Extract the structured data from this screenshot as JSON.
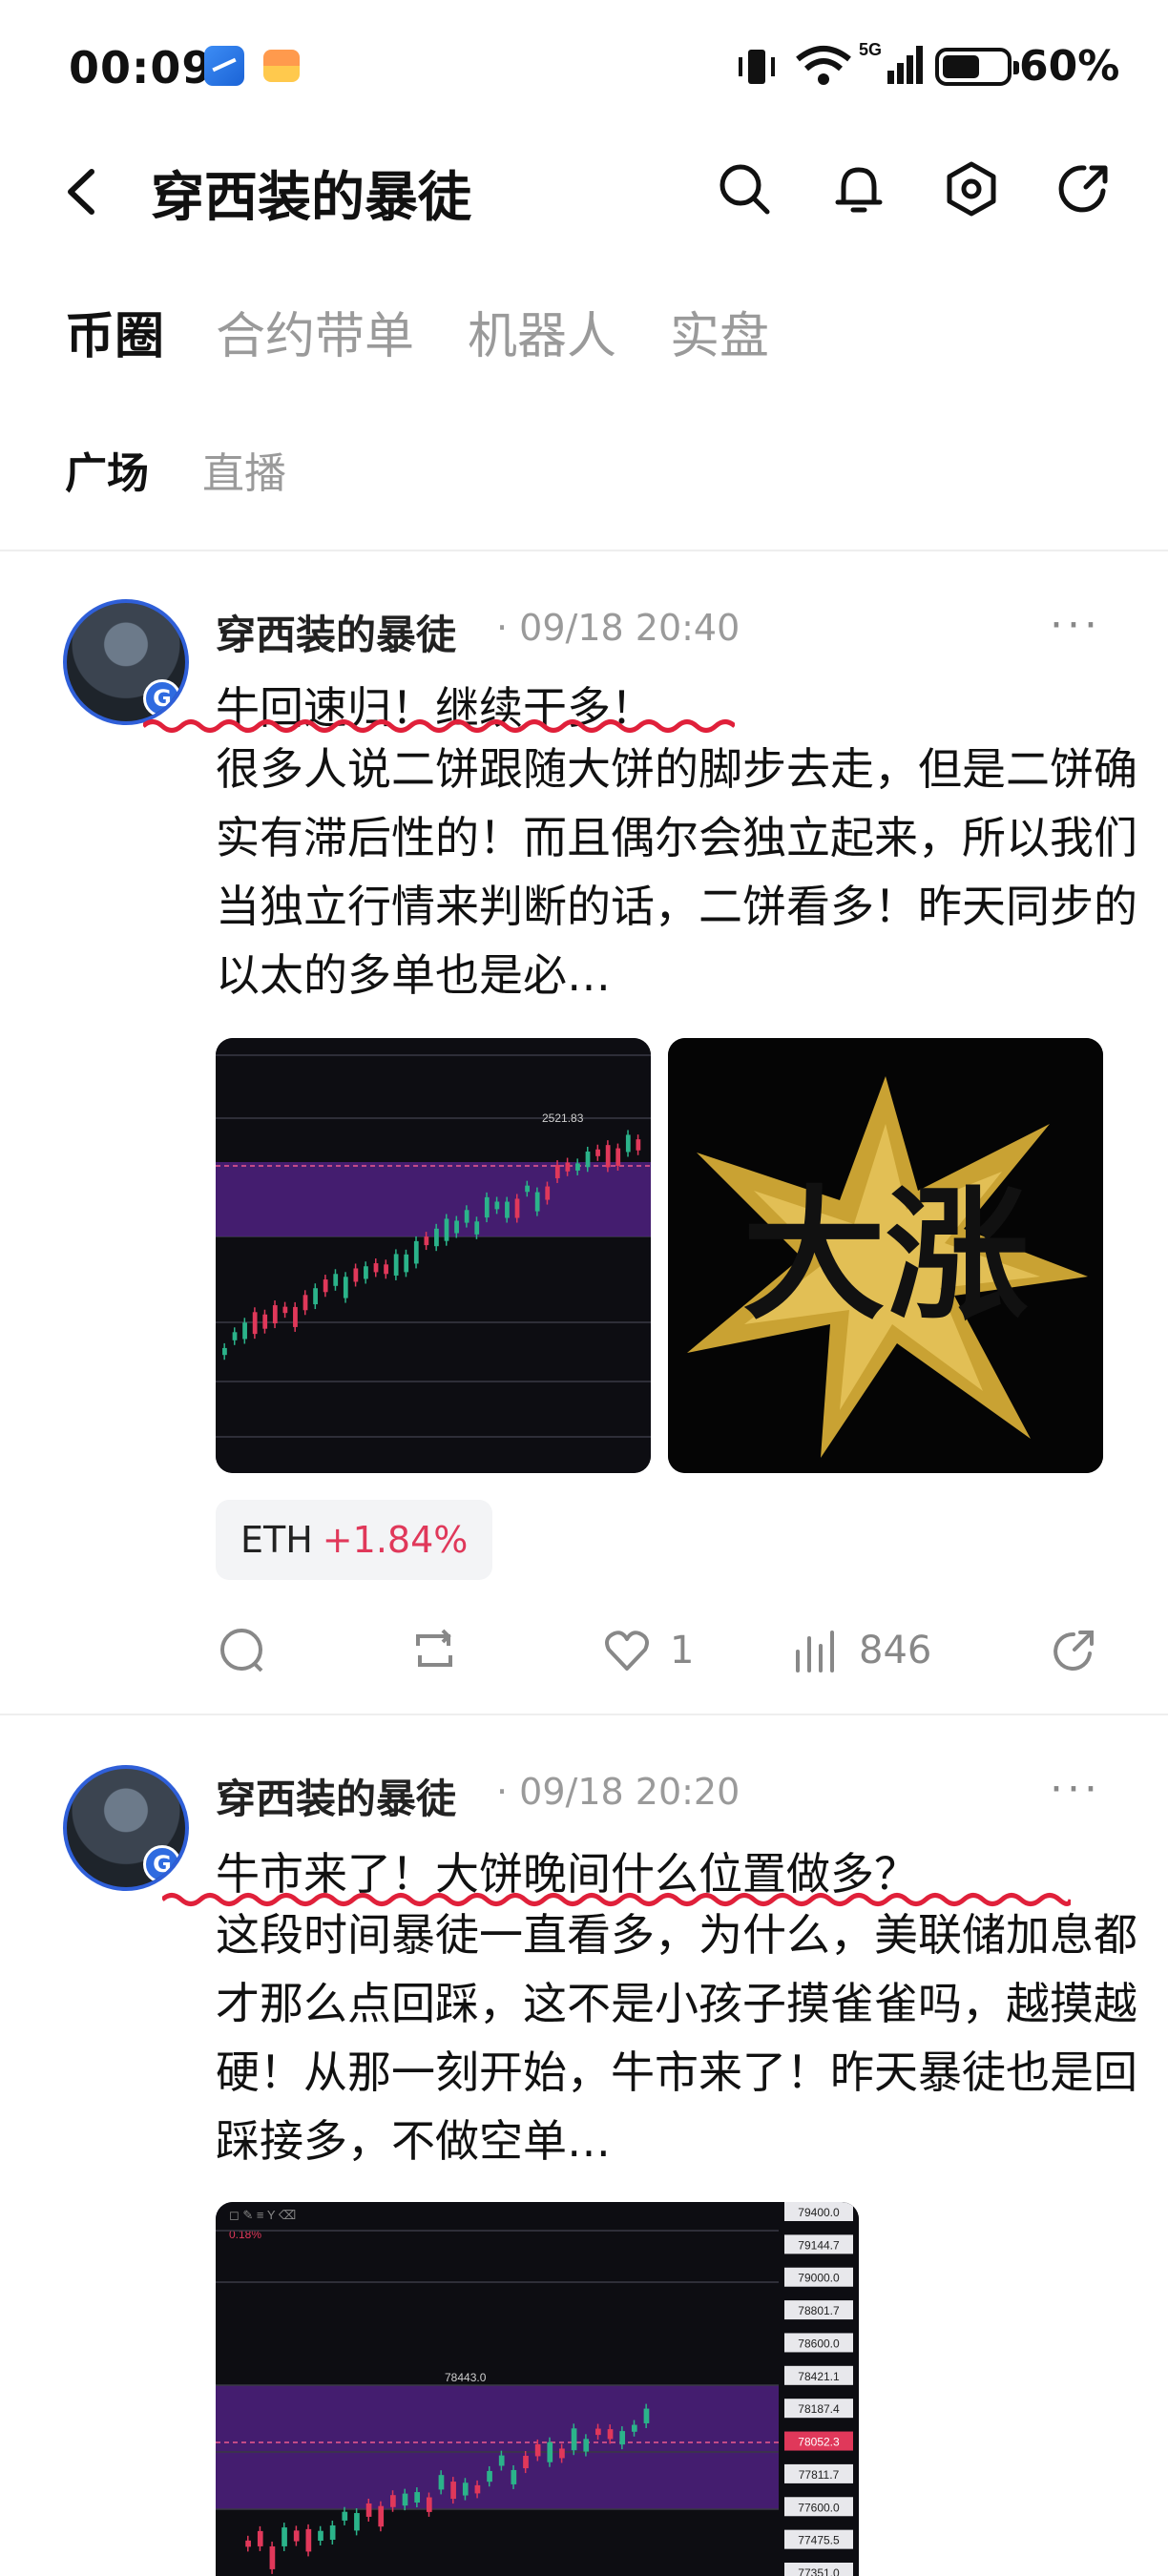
{
  "status_bar": {
    "time": "00:09",
    "network": "5G",
    "battery": "60%"
  },
  "header": {
    "title": "穿西装的暴徒"
  },
  "tabs": [
    {
      "label": "币圈",
      "active": true
    },
    {
      "label": "合约带单",
      "active": false
    },
    {
      "label": "机器人",
      "active": false
    },
    {
      "label": "实盘",
      "active": false
    }
  ],
  "subtabs": [
    {
      "label": "广场",
      "active": true
    },
    {
      "label": "直播",
      "active": false
    }
  ],
  "posts": [
    {
      "author": "穿西装的暴徒",
      "time": "09/18 20:40",
      "title": "牛回速归！继续干多！",
      "body": "很多人说二饼跟随大饼的脚步去走，但是二饼确实有滞后性的！而且偶尔会独立起来，所以我们当独立行情来判断的话，二饼看多！昨天同步的以太的多单也是必…",
      "chart_price_label": "2521.83",
      "image2_text": "大涨",
      "tag_symbol": "ETH",
      "tag_change": "+1.84%",
      "likes": "1",
      "views": "846"
    },
    {
      "author": "穿西装的暴徒",
      "time": "09/18 20:20",
      "title": "牛市来了！大饼晚间什么位置做多？",
      "body": "这段时间暴徒一直看多，为什么，美联储加息都才那么点回踩，这不是小孩子摸雀雀吗，越摸越硬！从那一刻开始，牛市来了！昨天暴徒也是回踩接多，不做空单…",
      "chart_price_label": "78443.0",
      "chart_pct": "0.18%",
      "chart_axis": [
        "79400.0",
        "79144.7",
        "79000.0",
        "78801.7",
        "78600.0",
        "78421.1",
        "78187.4",
        "78052.3",
        "77811.7",
        "77600.0",
        "77475.5",
        "77351.0"
      ]
    }
  ],
  "colors": {
    "accent_up": "#e0385a",
    "underline": "#e0203a",
    "avatar_ring": "#2f5fd8"
  }
}
